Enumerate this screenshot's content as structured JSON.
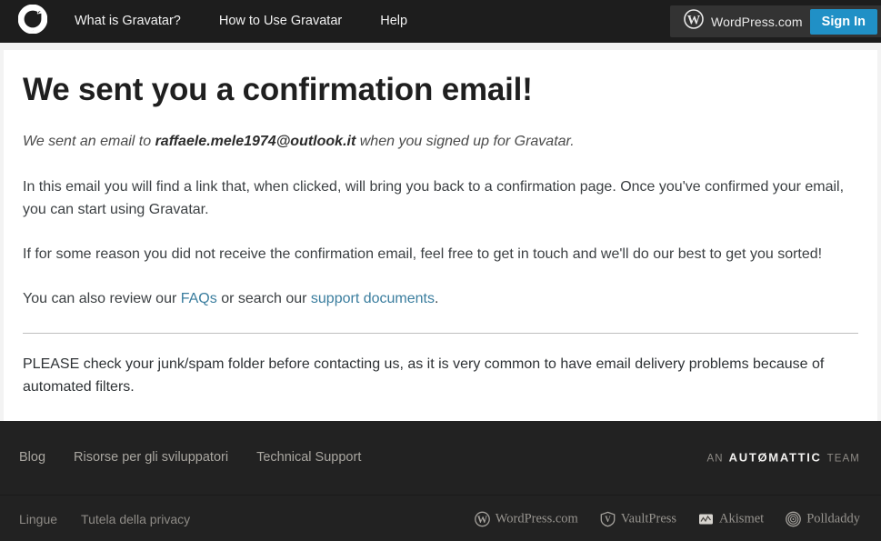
{
  "header": {
    "logo_icon": "gravatar-logo-icon",
    "nav": [
      {
        "label": "What is Gravatar?"
      },
      {
        "label": "How to Use Gravatar"
      },
      {
        "label": "Help"
      }
    ],
    "account": {
      "wordpress_icon": "wordpress-logo-icon",
      "wordpress_label": "WordPress.com",
      "signin_label": "Sign In"
    },
    "background_color": "#1d1d1d",
    "signin_color": "#2090c6"
  },
  "main": {
    "title": "We sent you a confirmation email!",
    "sent_line": {
      "before": "We sent an email to ",
      "email": "raffaele.mele1974@outlook.it",
      "after": " when you signed up for Gravatar."
    },
    "paragraph_1": "In this email you will find a link that, when clicked, will bring you back to a confirmation page. Once you've confirmed your email, you can start using Gravatar.",
    "paragraph_2": "If for some reason you did not receive the confirmation email, feel free to get in touch and we'll do our best to get you sorted!",
    "review_line": {
      "before": "You can also review our ",
      "link_1": "FAQs",
      "middle": " or search our ",
      "link_2": "support documents",
      "after": "."
    },
    "warning": "PLEASE check your junk/spam folder before contacting us, as it is very common to have email delivery problems because of automated filters.",
    "link_color": "#3a7d9e"
  },
  "footer": {
    "top_links": [
      {
        "label": "Blog"
      },
      {
        "label": "Risorse per gli sviluppatori"
      },
      {
        "label": "Technical Support"
      }
    ],
    "automattic": {
      "prefix": "AN",
      "word": "AUTØMATTIC",
      "suffix": "TEAM"
    },
    "bottom_links": [
      {
        "label": "Lingue"
      },
      {
        "label": "Tutela della privacy"
      }
    ],
    "services": [
      {
        "label": "WordPress.com",
        "icon": "wordpress-logo-icon"
      },
      {
        "label": "VaultPress",
        "icon": "vaultpress-shield-icon"
      },
      {
        "label": "Akismet",
        "icon": "akismet-chart-icon"
      },
      {
        "label": "Polldaddy",
        "icon": "polldaddy-circles-icon"
      }
    ],
    "background_color": "#222222"
  }
}
